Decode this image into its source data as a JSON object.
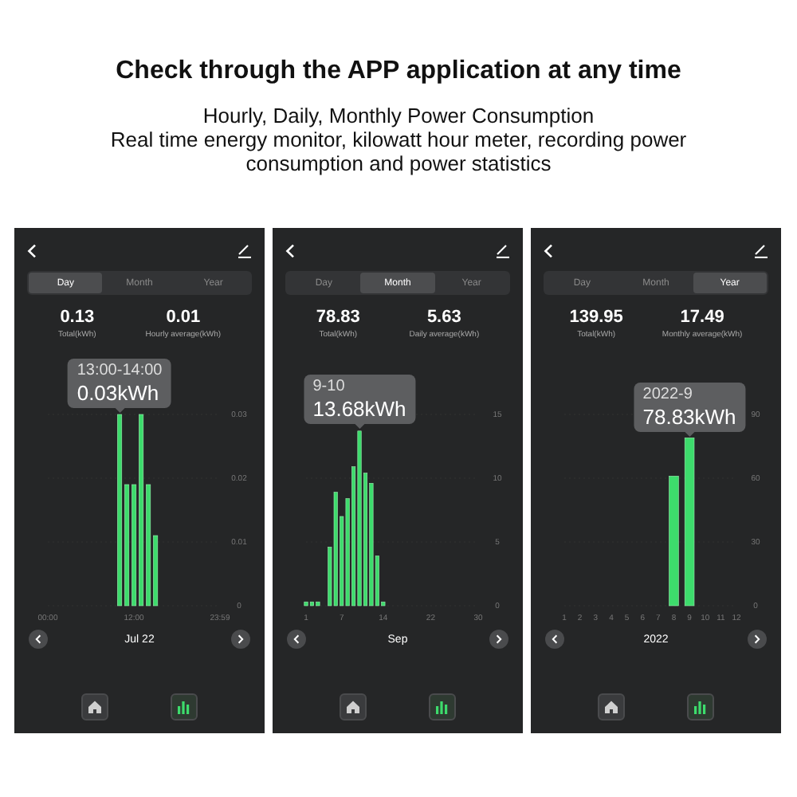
{
  "header": {
    "title": "Check through the APP application at any time",
    "lines": [
      "Hourly, Daily, Monthly Power Consumption",
      "Real time energy monitor, kilowatt hour meter, recording power consumption and power statistics"
    ]
  },
  "screens": [
    {
      "tabs": [
        {
          "label": "Day",
          "selected": true
        },
        {
          "label": "Month",
          "selected": false
        },
        {
          "label": "Year",
          "selected": false
        }
      ],
      "stats": [
        {
          "value": "0.13",
          "label": "Total(kWh)"
        },
        {
          "value": "0.01",
          "label": "Hourly average(kWh)"
        }
      ],
      "tooltip": {
        "label": "13:00-14:00",
        "value": "0.03kWh"
      },
      "chart_data": {
        "type": "bar",
        "x": [
          10,
          11,
          12,
          13,
          14,
          15
        ],
        "values": [
          0.03,
          0.019,
          0.019,
          0.03,
          0.019,
          0.011
        ],
        "grid": true,
        "xlim": [
          0,
          23.98
        ],
        "ylim": [
          0,
          0.03
        ],
        "xticks": [
          {
            "value": 0,
            "label": "00:00"
          },
          {
            "value": 12,
            "label": "12:00"
          },
          {
            "value": 23.98,
            "label": "23:59"
          }
        ],
        "yticks": [
          0,
          0.01,
          0.02,
          0.03
        ]
      },
      "period": "Jul 22",
      "nav_buttons": [
        {
          "kind": "home",
          "selected": false
        },
        {
          "kind": "stats",
          "selected": true
        }
      ]
    },
    {
      "tabs": [
        {
          "label": "Day",
          "selected": false
        },
        {
          "label": "Month",
          "selected": true
        },
        {
          "label": "Year",
          "selected": false
        }
      ],
      "stats": [
        {
          "value": "78.83",
          "label": "Total(kWh)"
        },
        {
          "value": "5.63",
          "label": "Daily average(kWh)"
        }
      ],
      "tooltip": {
        "label": "9-10",
        "value": "13.68kWh"
      },
      "chart_data": {
        "type": "bar",
        "x": [
          1,
          2,
          3,
          5,
          6,
          7,
          8,
          9,
          10,
          11,
          12,
          13,
          14
        ],
        "values": [
          0.3,
          0.3,
          0.3,
          4.6,
          8.9,
          7.0,
          8.4,
          10.9,
          13.7,
          10.4,
          9.6,
          3.9,
          0.3
        ],
        "grid": true,
        "xlim": [
          1,
          30
        ],
        "ylim": [
          0,
          15
        ],
        "xticks": [
          1,
          7,
          14,
          22,
          30
        ],
        "yticks": [
          0,
          5,
          10,
          15
        ]
      },
      "period": "Sep",
      "nav_buttons": [
        {
          "kind": "home",
          "selected": false
        },
        {
          "kind": "stats",
          "selected": true
        }
      ]
    },
    {
      "tabs": [
        {
          "label": "Day",
          "selected": false
        },
        {
          "label": "Month",
          "selected": false
        },
        {
          "label": "Year",
          "selected": true
        }
      ],
      "stats": [
        {
          "value": "139.95",
          "label": "Total(kWh)"
        },
        {
          "value": "17.49",
          "label": "Monthly average(kWh)"
        }
      ],
      "tooltip": {
        "label": "2022-9",
        "value": "78.83kWh"
      },
      "chart_data": {
        "type": "bar",
        "x": [
          8,
          9
        ],
        "values": [
          61,
          79
        ],
        "grid": true,
        "xlim": [
          1,
          12
        ],
        "ylim": [
          0,
          90
        ],
        "xticks": [
          1,
          2,
          3,
          4,
          5,
          6,
          7,
          8,
          9,
          10,
          11,
          12
        ],
        "yticks": [
          0,
          30,
          60,
          90
        ]
      },
      "period": "2022",
      "nav_buttons": [
        {
          "kind": "home",
          "selected": false
        },
        {
          "kind": "stats",
          "selected": true
        }
      ]
    }
  ]
}
